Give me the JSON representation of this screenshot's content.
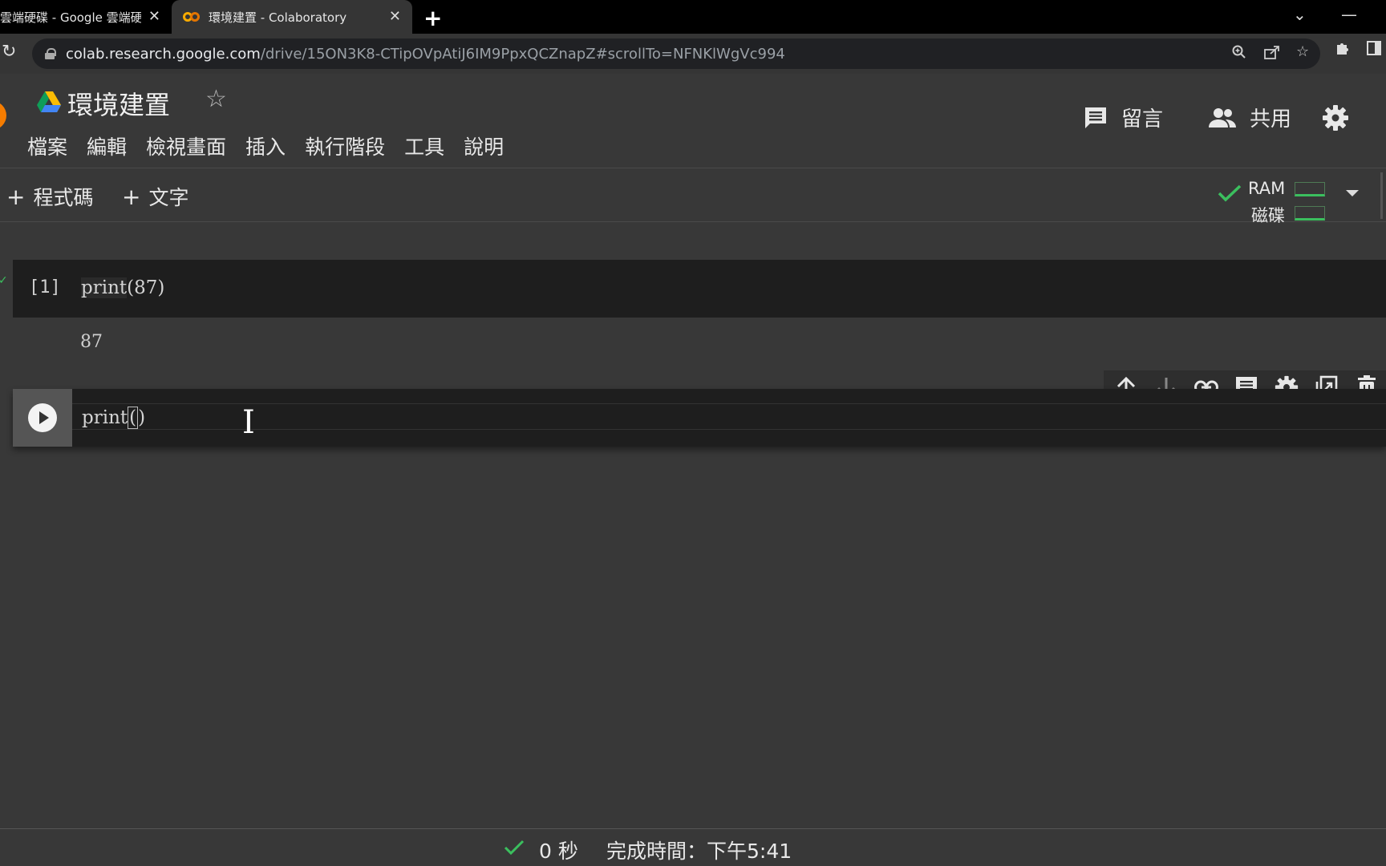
{
  "browser": {
    "tabs": [
      {
        "title": "雲端硬碟 - Google 雲端硬碟"
      },
      {
        "title": "環境建置 - Colaboratory"
      }
    ],
    "url_host": "colab.research.google.com",
    "url_path": "/drive/15ON3K8-CTipOVpAtiJ6IM9PpxQCZnapZ#scrollTo=NFNKlWgVc994"
  },
  "notebook": {
    "title": "環境建置",
    "menu": [
      "檔案",
      "編輯",
      "檢視畫面",
      "插入",
      "執行階段",
      "工具",
      "說明"
    ],
    "comment_label": "留言",
    "share_label": "共用"
  },
  "toolbar": {
    "add_code_label": "程式碼",
    "add_text_label": "文字",
    "ram_label": "RAM",
    "disk_label": "磁碟"
  },
  "cells": [
    {
      "exec_count": "[1]",
      "fn": "print",
      "args": "(87)",
      "output": "87"
    },
    {
      "fn": "print",
      "args_open": "(",
      "args_close": ")"
    }
  ],
  "status": {
    "elapsed": "0 秒",
    "done": "完成時間：下午5:41"
  },
  "colors": {
    "accent_green": "#3bbf5e",
    "colab_orange": "#f9ab00",
    "bg": "#383838",
    "cell_bg": "#1e1e1e"
  }
}
